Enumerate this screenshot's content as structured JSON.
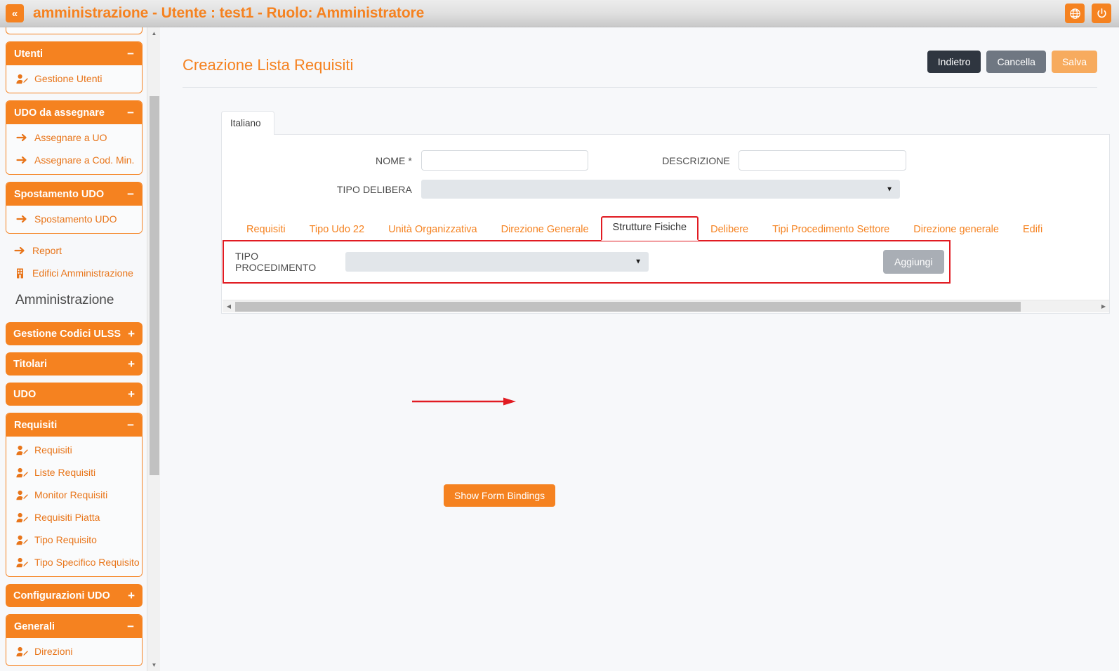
{
  "topbar": {
    "collapse_label": "«",
    "title": "amministrazione - Utente : test1 - Ruolo: Amministratore",
    "language_icon": "globe-icon",
    "power_icon": "power-icon"
  },
  "sidebar": {
    "groups": [
      {
        "id": "utenti",
        "title": "Utenti",
        "sign": "−",
        "expanded": true,
        "items": [
          {
            "label": "Gestione Utenti",
            "icon": "user-edit-icon"
          }
        ]
      },
      {
        "id": "udo-da-assegnare",
        "title": "UDO da assegnare",
        "sign": "−",
        "expanded": true,
        "items": [
          {
            "label": "Assegnare a UO",
            "icon": "arrow-right-icon"
          },
          {
            "label": "Assegnare a Cod. Min.",
            "icon": "arrow-right-icon"
          }
        ]
      },
      {
        "id": "spostamento-udo",
        "title": "Spostamento UDO",
        "sign": "−",
        "expanded": true,
        "items": [
          {
            "label": "Spostamento UDO",
            "icon": "arrow-right-icon"
          }
        ]
      }
    ],
    "standalone_items": [
      {
        "label": "Report",
        "icon": "arrow-right-icon"
      },
      {
        "label": "Edifici Amministrazione",
        "icon": "building-icon"
      }
    ],
    "section_title": "Amministrazione",
    "groups2": [
      {
        "id": "gestione-codici-ulss",
        "title": "Gestione Codici ULSS",
        "sign": "+",
        "expanded": false,
        "items": []
      },
      {
        "id": "titolari",
        "title": "Titolari",
        "sign": "+",
        "expanded": false,
        "items": []
      },
      {
        "id": "udo",
        "title": "UDO",
        "sign": "+",
        "expanded": false,
        "items": []
      },
      {
        "id": "requisiti",
        "title": "Requisiti",
        "sign": "−",
        "expanded": true,
        "items": [
          {
            "label": "Requisiti",
            "icon": "user-edit-icon"
          },
          {
            "label": "Liste Requisiti",
            "icon": "user-edit-icon"
          },
          {
            "label": "Monitor Requisiti",
            "icon": "user-edit-icon"
          },
          {
            "label": "Requisiti Piatta",
            "icon": "user-edit-icon"
          },
          {
            "label": "Tipo Requisito",
            "icon": "user-edit-icon"
          },
          {
            "label": "Tipo Specifico Requisito",
            "icon": "user-edit-icon"
          }
        ]
      },
      {
        "id": "configurazioni-udo",
        "title": "Configurazioni UDO",
        "sign": "+",
        "expanded": false,
        "items": []
      },
      {
        "id": "generali",
        "title": "Generali",
        "sign": "−",
        "expanded": true,
        "items": [
          {
            "label": "Direzioni",
            "icon": "user-edit-icon"
          }
        ]
      }
    ]
  },
  "main": {
    "page_title": "Creazione Lista Requisiti",
    "actions": [
      {
        "id": "indietro",
        "label": "Indietro",
        "style": "dark"
      },
      {
        "id": "cancella",
        "label": "Cancella",
        "style": "grey"
      },
      {
        "id": "salva",
        "label": "Salva",
        "style": "orange-light"
      }
    ],
    "lang_tab": "Italiano",
    "fields": {
      "nome_label": "NOME *",
      "nome_value": "",
      "descrizione_label": "DESCRIZIONE",
      "descrizione_value": "",
      "tipo_delibera_label": "TIPO DELIBERA",
      "tipo_delibera_value": ""
    },
    "tabs": [
      {
        "label": "Requisiti",
        "active": false
      },
      {
        "label": "Tipo Udo 22",
        "active": false
      },
      {
        "label": "Unità Organizzativa",
        "active": false
      },
      {
        "label": "Direzione Generale",
        "active": false
      },
      {
        "label": "Strutture Fisiche",
        "active": true
      },
      {
        "label": "Delibere",
        "active": false
      },
      {
        "label": "Tipi Procedimento Settore",
        "active": false
      },
      {
        "label": "Direzione generale",
        "active": false
      },
      {
        "label": "Edifi",
        "active": false
      }
    ],
    "tab_panel": {
      "tipo_procedimento_label": "TIPO PROCEDIMENTO",
      "tipo_procedimento_value": "",
      "aggiungi_label": "Aggiungi"
    },
    "show_bindings_label": "Show Form Bindings"
  },
  "colors": {
    "accent": "#f58220",
    "highlight": "#e11b22",
    "dark_button": "#2f3640",
    "grey_button": "#6f7782"
  }
}
